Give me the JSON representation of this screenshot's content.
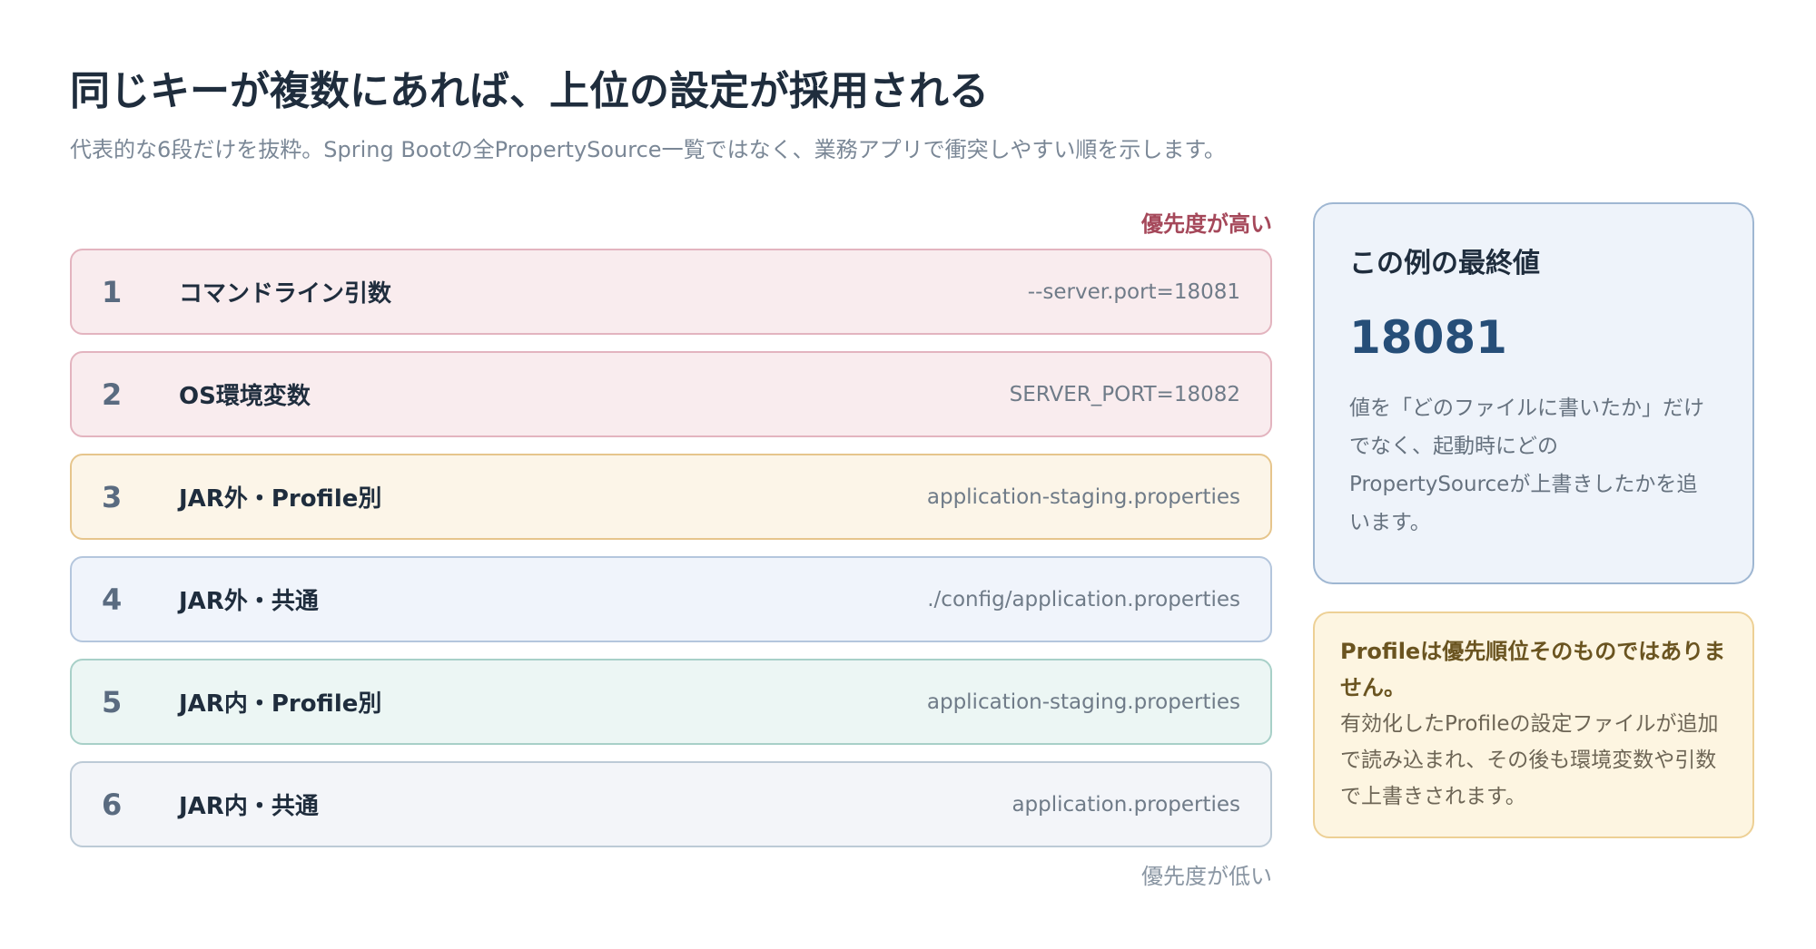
{
  "title": "同じキーが複数にあれば、上位の設定が採用される",
  "subtitle": "代表的な6段だけを抜粋。Spring Bootの全PropertySource一覧ではなく、業務アプリで衝突しやすい順を示します。",
  "priority_high": "優先度が高い",
  "priority_low": "優先度が低い",
  "rows": [
    {
      "num": "1",
      "label": "コマンドライン引数",
      "value": "--server.port=18081",
      "color": "#f9ecee"
    },
    {
      "num": "2",
      "label": "OS環境変数",
      "value": "SERVER_PORT=18082",
      "color": "#f9ecee"
    },
    {
      "num": "3",
      "label": "JAR外・Profile別",
      "value": "application-staging.properties",
      "color": "#fcf5e8"
    },
    {
      "num": "4",
      "label": "JAR外・共通",
      "value": "./config/application.properties",
      "color": "#f0f4fb"
    },
    {
      "num": "5",
      "label": "JAR内・Profile別",
      "value": "application-staging.properties",
      "color": "#ecf6f4"
    },
    {
      "num": "6",
      "label": "JAR内・共通",
      "value": "application.properties",
      "color": "#f3f5f9"
    }
  ],
  "final_card": {
    "title": "この例の最終値",
    "value": "18081",
    "description": "値を「どのファイルに書いたか」だけでなく、起動時にどのPropertySourceが上書きしたかを追います。"
  },
  "note_card": {
    "title": "Profileは優先順位そのものではありません。",
    "text": "有効化したProfileの設定ファイルが追加で読み込まれ、その後も環境変数や引数で上書きされます。"
  }
}
